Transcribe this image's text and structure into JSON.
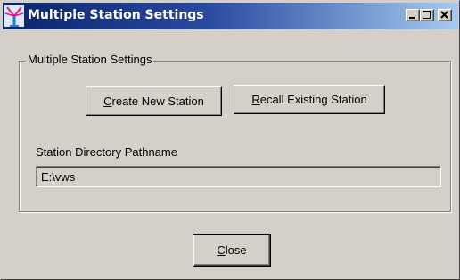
{
  "window": {
    "title": "Multiple Station Settings",
    "controls": {
      "minimize": "minimize-icon",
      "maximize": "maximize-icon",
      "close": "close-icon"
    }
  },
  "group": {
    "label": "Multiple Station Settings"
  },
  "buttons": {
    "create_mnemonic": "C",
    "create_rest": "reate New Station",
    "recall_mnemonic": "R",
    "recall_rest": "ecall Existing Station",
    "close_mnemonic": "C",
    "close_rest": "lose"
  },
  "directory": {
    "label": "Station Directory Pathname",
    "value": "E:\\vws"
  },
  "colors": {
    "titlebar_start": "#0a246a",
    "titlebar_end": "#a6caf0",
    "face": "#d4d0c8"
  }
}
